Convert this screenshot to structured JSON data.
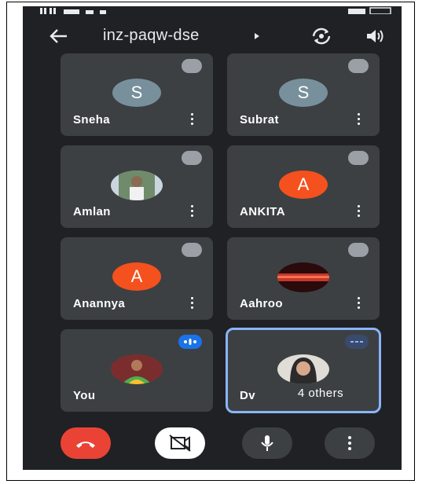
{
  "meeting": {
    "title": "inz-paqw-dse"
  },
  "colors": {
    "background": "#202124",
    "tile": "#3c4043",
    "end_call": "#ea4335",
    "active_border": "#8ab4f8",
    "speaking": "#1a73e8"
  },
  "participants": [
    {
      "name": "Sneha",
      "avatar_letter": "S",
      "avatar_color": "#78909c",
      "muted": true
    },
    {
      "name": "Subrat",
      "avatar_letter": "S",
      "avatar_color": "#78909c",
      "muted": true
    },
    {
      "name": "Amlan",
      "avatar_type": "photo",
      "muted": true
    },
    {
      "name": "ANKITA",
      "avatar_letter": "A",
      "avatar_color": "#f4511e",
      "muted": true
    },
    {
      "name": "Anannya",
      "avatar_letter": "A",
      "avatar_color": "#f4511e",
      "muted": true
    },
    {
      "name": "Aahroo",
      "avatar_type": "photo",
      "muted": true
    },
    {
      "name": "You",
      "avatar_type": "photo",
      "speaking": true
    },
    {
      "name": "Dv",
      "avatar_type": "photo",
      "others_label": "4 others"
    }
  ],
  "icons": {
    "back": "back-arrow-icon",
    "switch_camera": "switch-camera-icon",
    "speaker": "speaker-icon",
    "end_call": "end-call-icon",
    "camera_off": "camera-off-icon",
    "mic": "mic-icon",
    "more": "more-vert-icon"
  }
}
